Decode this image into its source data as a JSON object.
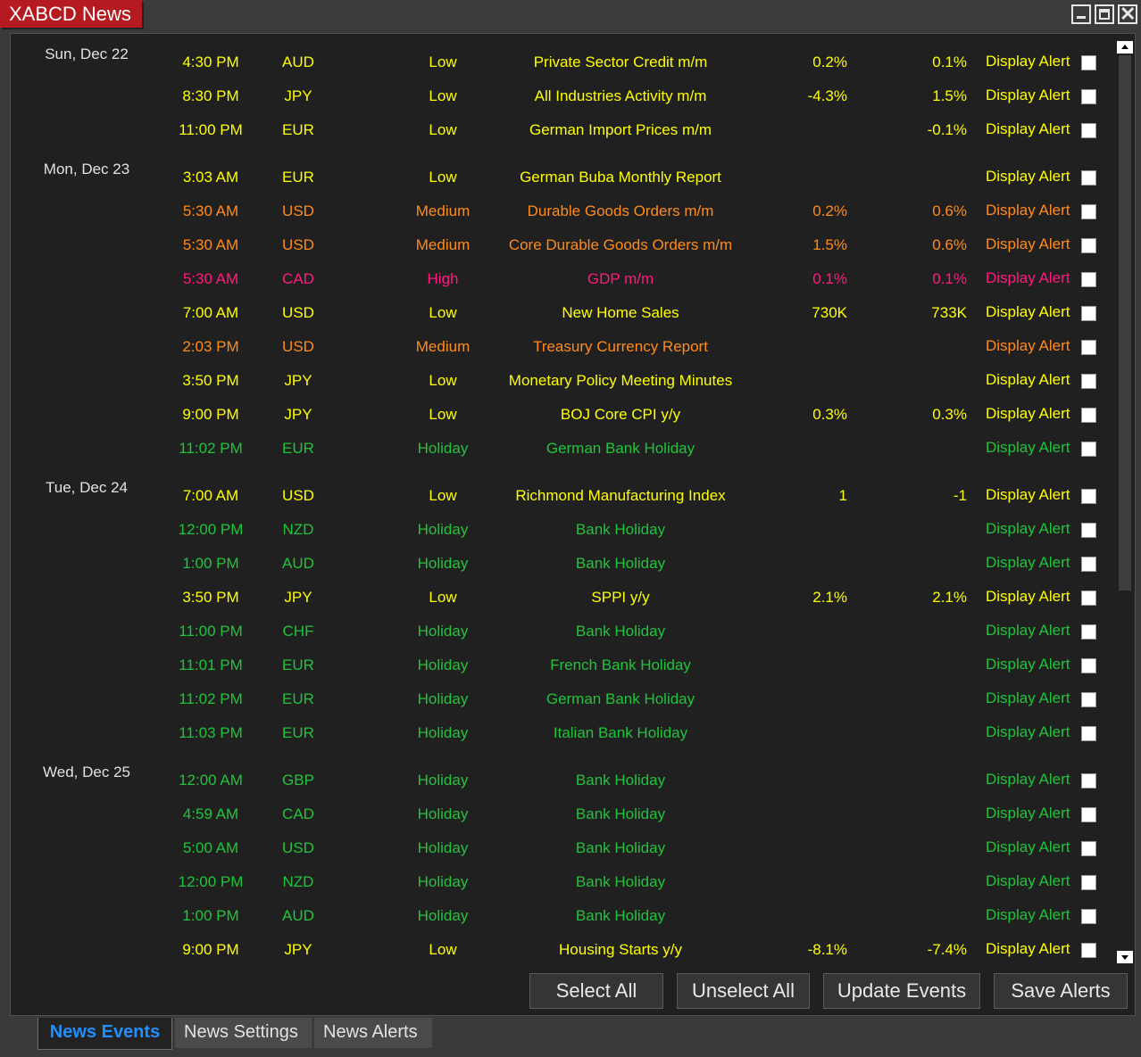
{
  "window": {
    "title": "XABCD News"
  },
  "days": [
    {
      "label": "Sun, Dec 22",
      "events": [
        {
          "time": "4:30 PM",
          "currency": "AUD",
          "impact": "Low",
          "name": "Private Sector Credit m/m",
          "actual": "0.2%",
          "forecast": "0.1%",
          "alert": "Display Alert",
          "level": "low"
        },
        {
          "time": "8:30 PM",
          "currency": "JPY",
          "impact": "Low",
          "name": "All Industries Activity m/m",
          "actual": "-4.3%",
          "forecast": "1.5%",
          "alert": "Display Alert",
          "level": "low"
        },
        {
          "time": "11:00 PM",
          "currency": "EUR",
          "impact": "Low",
          "name": "German Import Prices m/m",
          "actual": "",
          "forecast": "-0.1%",
          "alert": "Display Alert",
          "level": "low"
        }
      ]
    },
    {
      "label": "Mon, Dec 23",
      "events": [
        {
          "time": "3:03 AM",
          "currency": "EUR",
          "impact": "Low",
          "name": "German Buba Monthly Report",
          "actual": "",
          "forecast": "",
          "alert": "Display Alert",
          "level": "low"
        },
        {
          "time": "5:30 AM",
          "currency": "USD",
          "impact": "Medium",
          "name": "Durable Goods Orders m/m",
          "actual": "0.2%",
          "forecast": "0.6%",
          "alert": "Display Alert",
          "level": "medium"
        },
        {
          "time": "5:30 AM",
          "currency": "USD",
          "impact": "Medium",
          "name": "Core Durable Goods Orders m/m",
          "actual": "1.5%",
          "forecast": "0.6%",
          "alert": "Display Alert",
          "level": "medium"
        },
        {
          "time": "5:30 AM",
          "currency": "CAD",
          "impact": "High",
          "name": "GDP m/m",
          "actual": "0.1%",
          "forecast": "0.1%",
          "alert": "Display Alert",
          "level": "high"
        },
        {
          "time": "7:00 AM",
          "currency": "USD",
          "impact": "Low",
          "name": "New Home Sales",
          "actual": "730K",
          "forecast": "733K",
          "alert": "Display Alert",
          "level": "low"
        },
        {
          "time": "2:03 PM",
          "currency": "USD",
          "impact": "Medium",
          "name": "Treasury Currency Report",
          "actual": "",
          "forecast": "",
          "alert": "Display Alert",
          "level": "medium"
        },
        {
          "time": "3:50 PM",
          "currency": "JPY",
          "impact": "Low",
          "name": "Monetary Policy Meeting Minutes",
          "actual": "",
          "forecast": "",
          "alert": "Display Alert",
          "level": "low"
        },
        {
          "time": "9:00 PM",
          "currency": "JPY",
          "impact": "Low",
          "name": "BOJ Core CPI y/y",
          "actual": "0.3%",
          "forecast": "0.3%",
          "alert": "Display Alert",
          "level": "low"
        },
        {
          "time": "11:02 PM",
          "currency": "EUR",
          "impact": "Holiday",
          "name": "German Bank Holiday",
          "actual": "",
          "forecast": "",
          "alert": "Display Alert",
          "level": "holiday"
        }
      ]
    },
    {
      "label": "Tue, Dec 24",
      "events": [
        {
          "time": "7:00 AM",
          "currency": "USD",
          "impact": "Low",
          "name": "Richmond Manufacturing Index",
          "actual": "1",
          "forecast": "-1",
          "alert": "Display Alert",
          "level": "low"
        },
        {
          "time": "12:00 PM",
          "currency": "NZD",
          "impact": "Holiday",
          "name": "Bank Holiday",
          "actual": "",
          "forecast": "",
          "alert": "Display Alert",
          "level": "holiday"
        },
        {
          "time": "1:00 PM",
          "currency": "AUD",
          "impact": "Holiday",
          "name": "Bank Holiday",
          "actual": "",
          "forecast": "",
          "alert": "Display Alert",
          "level": "holiday"
        },
        {
          "time": "3:50 PM",
          "currency": "JPY",
          "impact": "Low",
          "name": "SPPI y/y",
          "actual": "2.1%",
          "forecast": "2.1%",
          "alert": "Display Alert",
          "level": "low"
        },
        {
          "time": "11:00 PM",
          "currency": "CHF",
          "impact": "Holiday",
          "name": "Bank Holiday",
          "actual": "",
          "forecast": "",
          "alert": "Display Alert",
          "level": "holiday"
        },
        {
          "time": "11:01 PM",
          "currency": "EUR",
          "impact": "Holiday",
          "name": "French Bank Holiday",
          "actual": "",
          "forecast": "",
          "alert": "Display Alert",
          "level": "holiday"
        },
        {
          "time": "11:02 PM",
          "currency": "EUR",
          "impact": "Holiday",
          "name": "German Bank Holiday",
          "actual": "",
          "forecast": "",
          "alert": "Display Alert",
          "level": "holiday"
        },
        {
          "time": "11:03 PM",
          "currency": "EUR",
          "impact": "Holiday",
          "name": "Italian Bank Holiday",
          "actual": "",
          "forecast": "",
          "alert": "Display Alert",
          "level": "holiday"
        }
      ]
    },
    {
      "label": "Wed, Dec 25",
      "events": [
        {
          "time": "12:00 AM",
          "currency": "GBP",
          "impact": "Holiday",
          "name": "Bank Holiday",
          "actual": "",
          "forecast": "",
          "alert": "Display Alert",
          "level": "holiday"
        },
        {
          "time": "4:59 AM",
          "currency": "CAD",
          "impact": "Holiday",
          "name": "Bank Holiday",
          "actual": "",
          "forecast": "",
          "alert": "Display Alert",
          "level": "holiday"
        },
        {
          "time": "5:00 AM",
          "currency": "USD",
          "impact": "Holiday",
          "name": "Bank Holiday",
          "actual": "",
          "forecast": "",
          "alert": "Display Alert",
          "level": "holiday"
        },
        {
          "time": "12:00 PM",
          "currency": "NZD",
          "impact": "Holiday",
          "name": "Bank Holiday",
          "actual": "",
          "forecast": "",
          "alert": "Display Alert",
          "level": "holiday"
        },
        {
          "time": "1:00 PM",
          "currency": "AUD",
          "impact": "Holiday",
          "name": "Bank Holiday",
          "actual": "",
          "forecast": "",
          "alert": "Display Alert",
          "level": "holiday"
        },
        {
          "time": "9:00 PM",
          "currency": "JPY",
          "impact": "Low",
          "name": "Housing Starts y/y",
          "actual": "-8.1%",
          "forecast": "-7.4%",
          "alert": "Display Alert",
          "level": "low"
        }
      ]
    }
  ],
  "buttons": {
    "select_all": "Select All",
    "unselect_all": "Unselect All",
    "update_events": "Update Events",
    "save_alerts": "Save Alerts"
  },
  "tabs": [
    {
      "label": "News Events",
      "active": true
    },
    {
      "label": "News Settings",
      "active": false
    },
    {
      "label": "News Alerts",
      "active": false
    }
  ],
  "colors": {
    "low": "#ffff00",
    "medium": "#ff8c1a",
    "high": "#ff1a80",
    "holiday": "#22c33c",
    "title_bg": "#b41a1f",
    "active_tab": "#1e90ff"
  }
}
